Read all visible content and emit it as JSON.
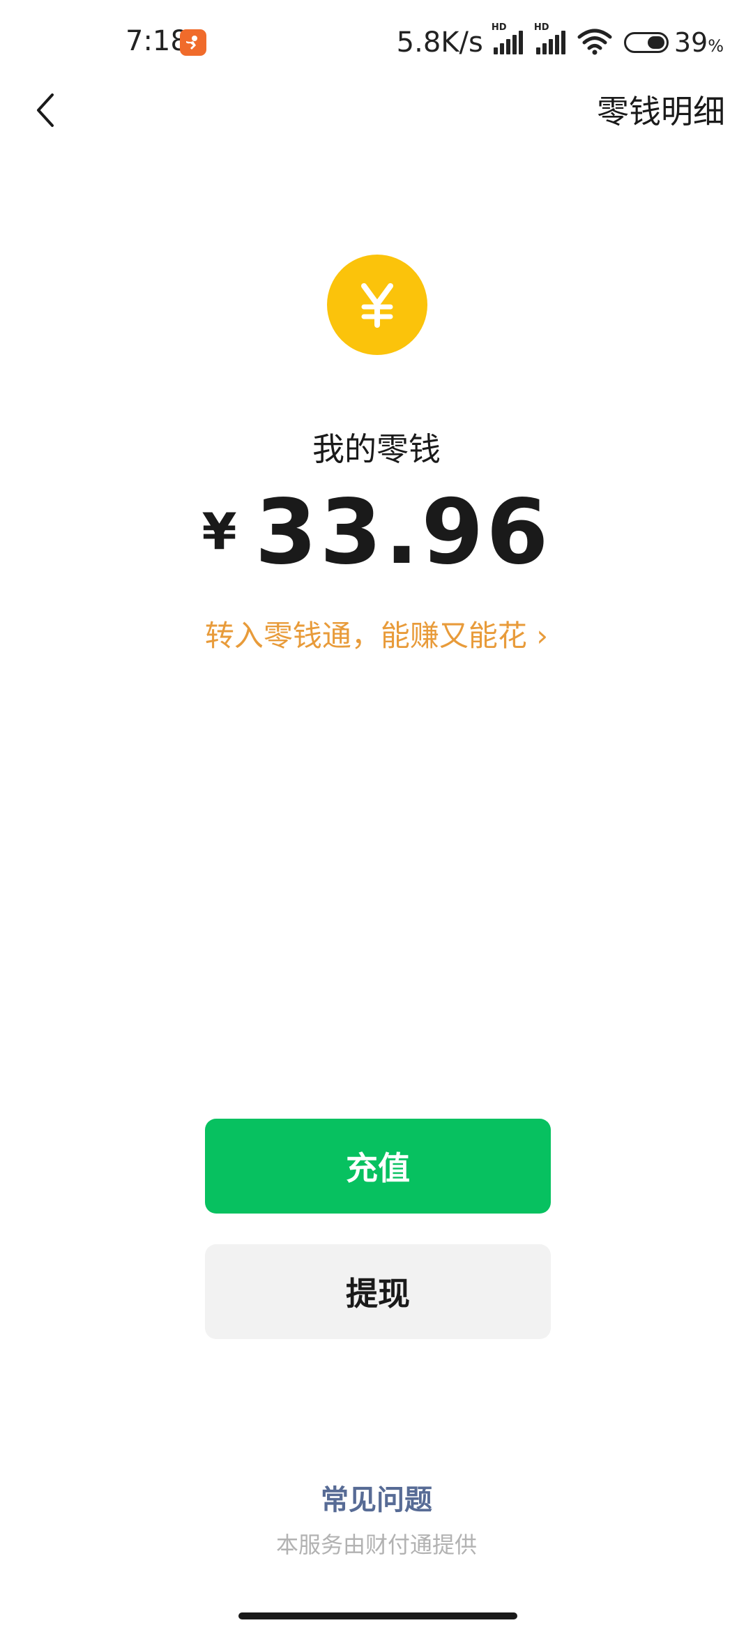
{
  "status_bar": {
    "time": "7:18",
    "network_speed": "5.8K/s",
    "hd_label_1": "HD",
    "hd_label_2": "HD",
    "battery_number": "39",
    "battery_unit": "%",
    "app_badge_icon": "taobao-style-app-icon",
    "badge_color": "#f06b2b"
  },
  "nav": {
    "back_icon": "chevron-left-icon",
    "title": "零钱明细"
  },
  "wallet": {
    "coin_icon": "yuan-coin-icon",
    "coin_color": "#fbc30b",
    "label": "我的零钱",
    "currency_symbol": "¥",
    "amount": "33.96",
    "promo_link": "转入零钱通，能赚又能花 ›",
    "promo_color": "#e89b3a"
  },
  "actions": {
    "top_up_label": "充值",
    "top_up_color": "#07c160",
    "withdraw_label": "提现",
    "withdraw_color": "#f2f2f2"
  },
  "footer": {
    "faq_link": "常见问题",
    "faq_color": "#576b95",
    "provider_text": "本服务由财付通提供"
  }
}
